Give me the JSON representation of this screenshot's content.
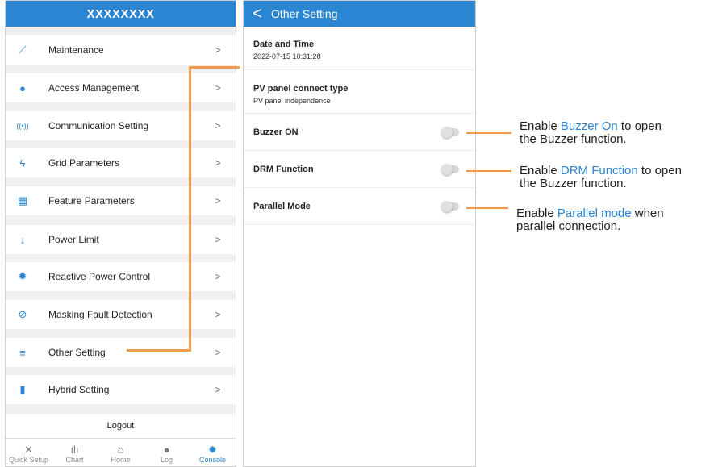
{
  "left_panel": {
    "title": "XXXXXXXX",
    "menu": [
      {
        "label": "Maintenance",
        "icon": "wrench-icon",
        "glyph": "⟋"
      },
      {
        "label": "Access Management",
        "icon": "user-icon",
        "glyph": "●"
      },
      {
        "label": "Communication Setting",
        "icon": "signal-icon",
        "glyph": "((•))"
      },
      {
        "label": "Grid Parameters",
        "icon": "lightning-icon",
        "glyph": "ϟ"
      },
      {
        "label": "Feature Parameters",
        "icon": "grid-icon",
        "glyph": "▦"
      },
      {
        "label": "Power Limit",
        "icon": "arrow-down-icon",
        "glyph": "↓"
      },
      {
        "label": "Reactive Power Control",
        "icon": "gear-icon",
        "glyph": "✹"
      },
      {
        "label": "Masking Fault Detection",
        "icon": "bell-off-icon",
        "glyph": "⊘"
      },
      {
        "label": "Other Setting",
        "icon": "menu-icon",
        "glyph": "≡"
      },
      {
        "label": "Hybrid Setting",
        "icon": "battery-icon",
        "glyph": "▮"
      }
    ],
    "chevron": ">",
    "logout_label": "Logout",
    "tabs": [
      {
        "label": "Quick Setup",
        "icon": "tools-icon",
        "glyph": "✕"
      },
      {
        "label": "Chart",
        "icon": "chart-icon",
        "glyph": "ılı"
      },
      {
        "label": "Home",
        "icon": "home-icon",
        "glyph": "⌂"
      },
      {
        "label": "Log",
        "icon": "log-icon",
        "glyph": "●"
      },
      {
        "label": "Console",
        "icon": "console-icon",
        "glyph": "✹",
        "active": true
      }
    ]
  },
  "right_panel": {
    "back_glyph": "<",
    "title": "Other Setting",
    "date_time": {
      "label": "Date and Time",
      "value": "2022-07-15 10:31:28"
    },
    "pv_type": {
      "label": "PV panel connect type",
      "value": "PV panel independence"
    },
    "toggles": [
      {
        "label": "Buzzer ON",
        "state": "off"
      },
      {
        "label": "DRM Function",
        "state": "off"
      },
      {
        "label": "Parallel Mode",
        "state": "off"
      }
    ]
  },
  "notes": [
    {
      "pre": "Enable ",
      "highlight": "Buzzer On",
      "post": " to open",
      "line2": "the Buzzer function."
    },
    {
      "pre": "Enable ",
      "highlight": "DRM Function",
      "post": " to open",
      "line2": "the Buzzer function."
    },
    {
      "pre": "Enable ",
      "highlight": "Parallel mode",
      "post": " when",
      "line2": "parallel connection."
    }
  ],
  "colors": {
    "accent": "#2a85d2",
    "connector": "#f19a4a"
  }
}
